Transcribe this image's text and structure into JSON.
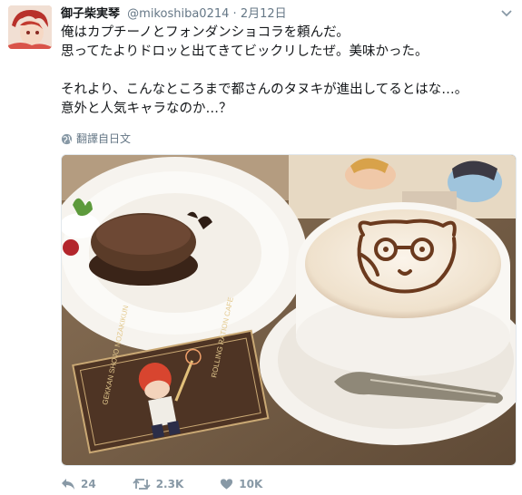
{
  "tweet": {
    "author_name": "御子柴実琴",
    "handle": "@mikoshiba0214",
    "separator": "·",
    "date": "2月12日",
    "lines": [
      "俺はカプチーノとフォンダンショコラを頼んだ。",
      "思ってたよりドロッと出てきてビックリしたぜ。美味かった。",
      "",
      "それより、こんなところまで都さんのタヌキが進出してるとはな…。",
      "意外と人気キャラなのか…？"
    ],
    "translate_label": "翻譯自日文"
  },
  "photo": {
    "card_text_left": "GEKKAN SHOJO NOZAKIKUN",
    "card_text_right": "ROLLING RATION CAFE"
  },
  "actions": {
    "reply_count": "24",
    "retweet_count": "2.3K",
    "like_count": "10K"
  },
  "icons": [
    "globe-icon",
    "reply-icon",
    "retweet-icon",
    "like-icon",
    "chevron-down-icon"
  ],
  "colors": {
    "muted": "#657786",
    "action": "#8899a6"
  }
}
